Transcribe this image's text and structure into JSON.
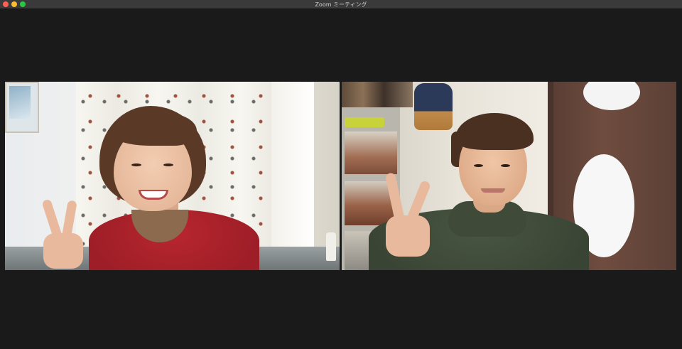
{
  "window": {
    "title": "Zoom ミーティング",
    "controls": [
      "close",
      "minimize",
      "zoom"
    ]
  },
  "participants": [
    {
      "slot": "left-video-tile"
    },
    {
      "slot": "right-video-tile"
    }
  ]
}
